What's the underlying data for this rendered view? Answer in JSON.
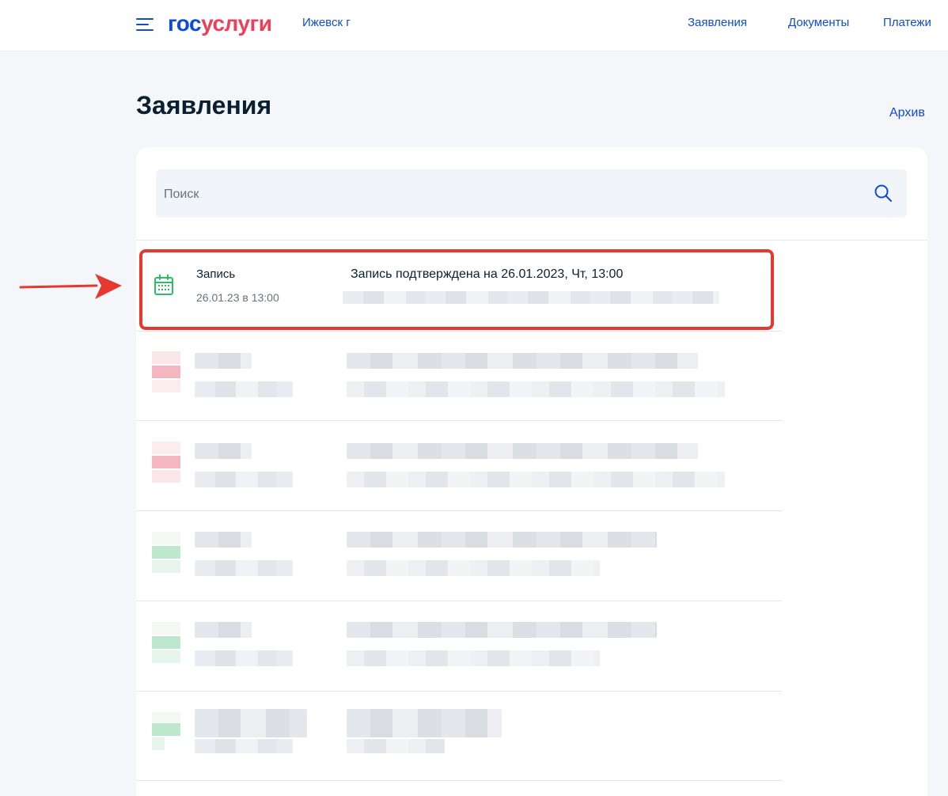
{
  "header": {
    "logo_part1": "гос",
    "logo_part2": "услуги",
    "city": "Ижевск г",
    "nav": [
      "Заявления",
      "Документы",
      "Платежи"
    ]
  },
  "page": {
    "title": "Заявления",
    "archive_label": "Архив"
  },
  "search": {
    "placeholder": "Поиск"
  },
  "highlighted_item": {
    "icon": "calendar-icon",
    "title": "Запись",
    "date": "26.01.23 в 13:00",
    "status": "Запись подтверждена на 26.01.2023, Чт, 13:00"
  },
  "colors": {
    "accent": "#0d4cd3",
    "logo_red": "#ee3f58",
    "highlight_border": "#e5382f",
    "icon_green": "#2dbe64",
    "status_red": "#f4b6c0",
    "status_green": "#bde8cd"
  }
}
